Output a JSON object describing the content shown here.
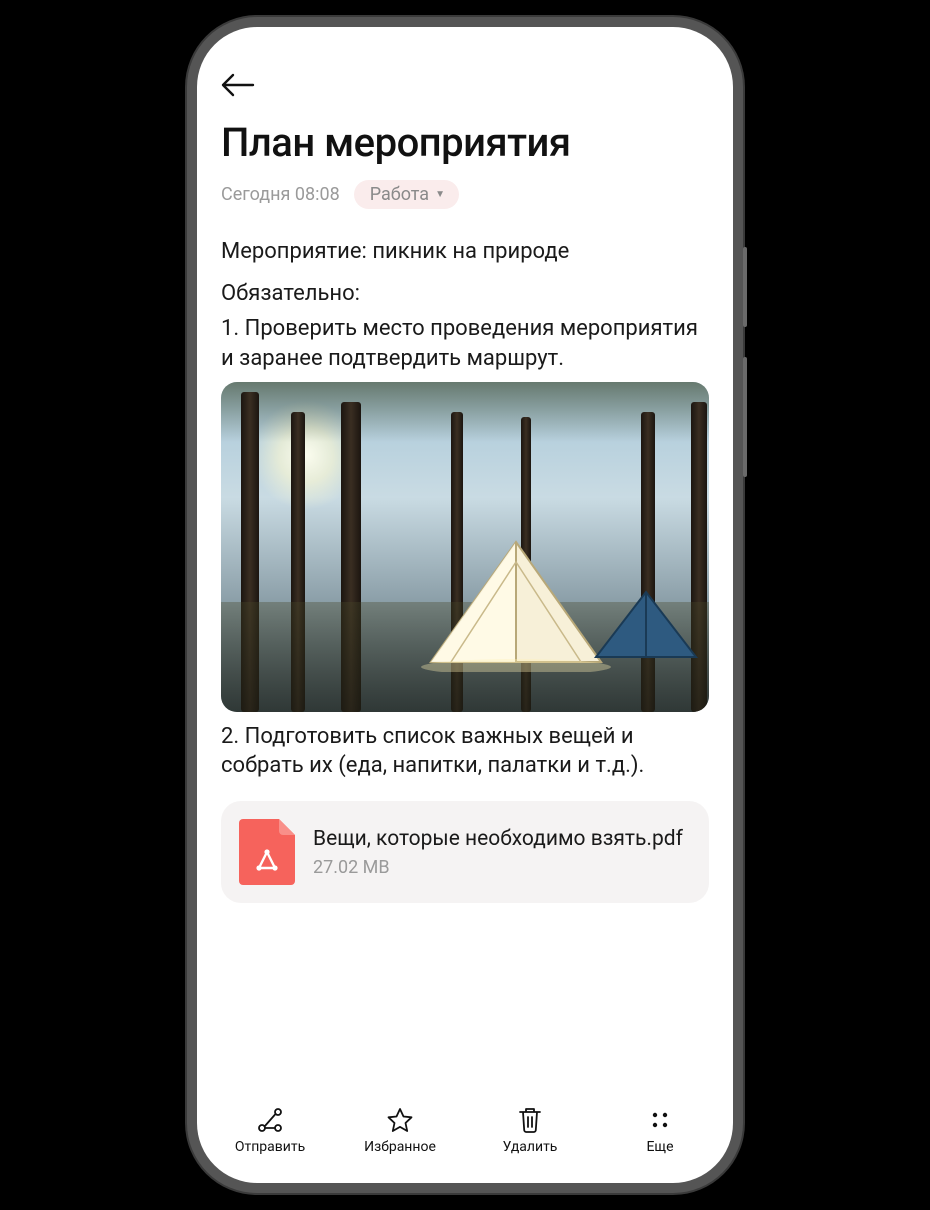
{
  "header": {
    "title": "План мероприятия",
    "timestamp": "Сегодня 08:08",
    "tag_label": "Работа"
  },
  "body": {
    "subtitle": "Мероприятие: пикник на природе",
    "must_label": "Обязательно:",
    "item1": "1. Проверить место проведения мероприятия и заранее подтвердить маршрут.",
    "item2": "2. Подготовить список важных вещей и собрать их (еда, напитки, палатки и т.д.)."
  },
  "attachment": {
    "filename": "Вещи, которые необходимо взять.pdf",
    "filesize": "27.02 MB"
  },
  "bottombar": {
    "send": "Отправить",
    "favorite": "Избранное",
    "delete": "Удалить",
    "more": "Еще"
  }
}
